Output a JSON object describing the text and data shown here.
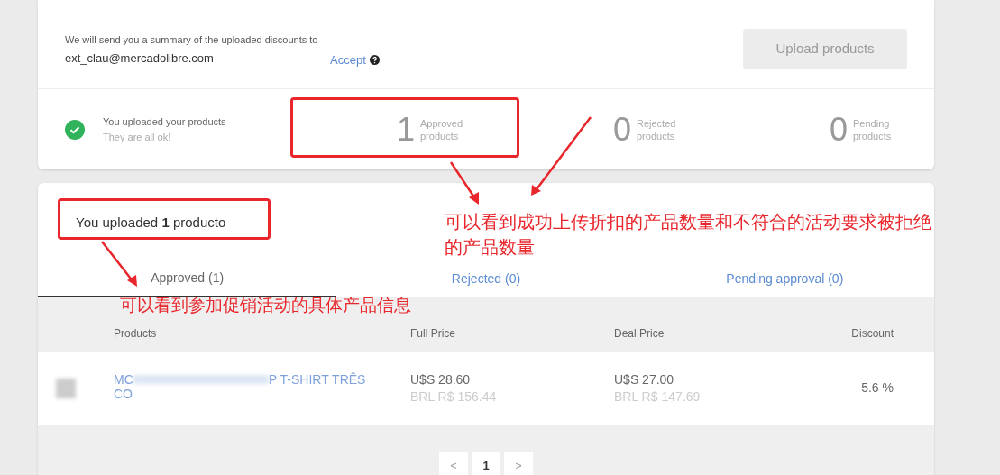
{
  "upload_card": {
    "summary_label": "We will send you a summary of the uploaded discounts to",
    "email_field": {
      "value": "ext_clau@mercadolibre.com"
    },
    "accept_link": "Accept",
    "upload_button": {
      "label": "Upload products",
      "disabled": true
    },
    "status": {
      "title": "You uploaded your products",
      "subtitle": "They are all ok!"
    },
    "counters": [
      {
        "count": "1",
        "label": "Approved products"
      },
      {
        "count": "0",
        "label": "Rejected products"
      },
      {
        "count": "0",
        "label": "Pending products"
      }
    ]
  },
  "results_card": {
    "heading": "You uploaded **1** producto",
    "tabs": [
      {
        "label": "Approved (1)",
        "selected": true
      },
      {
        "label": "Rejected (0)",
        "selected": false
      },
      {
        "label": "Pending approval (0)",
        "selected": false
      }
    ],
    "table": {
      "columns": [
        "Products",
        "Full Price",
        "Deal Price",
        "Discount"
      ],
      "rows": [
        {
          "product_start": "MC",
          "product_end": "P T-SHIRT TRÊS",
          "product_line2": "CO",
          "full_price": "U$S 28.60",
          "full_price_local": "BRL R$ 156.44",
          "deal_price": "U$S 27.00",
          "deal_price_local": "BRL R$ 147.69",
          "discount": "5.6 %"
        }
      ]
    },
    "pagination": {
      "prev": "<",
      "pages": [
        {
          "label": "1",
          "selected": true
        }
      ],
      "next": ">"
    }
  },
  "annotations": [
    {
      "kind": "box"
    },
    {
      "kind": "box"
    },
    {
      "kind": "note",
      "text": "可以看到成功上传折扣的产品数量和不符合的活动要求被拒绝的产品数量"
    },
    {
      "kind": "note",
      "text": "可以看到参加促销活动的具体产品信息"
    }
  ]
}
